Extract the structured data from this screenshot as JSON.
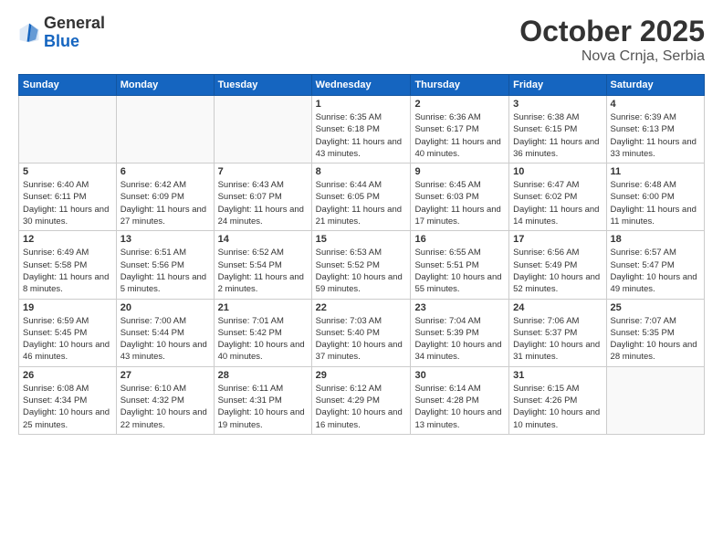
{
  "logo": {
    "general": "General",
    "blue": "Blue"
  },
  "header": {
    "month": "October 2025",
    "location": "Nova Crnja, Serbia"
  },
  "days_of_week": [
    "Sunday",
    "Monday",
    "Tuesday",
    "Wednesday",
    "Thursday",
    "Friday",
    "Saturday"
  ],
  "weeks": [
    [
      {
        "day": "",
        "info": ""
      },
      {
        "day": "",
        "info": ""
      },
      {
        "day": "",
        "info": ""
      },
      {
        "day": "1",
        "info": "Sunrise: 6:35 AM\nSunset: 6:18 PM\nDaylight: 11 hours\nand 43 minutes."
      },
      {
        "day": "2",
        "info": "Sunrise: 6:36 AM\nSunset: 6:17 PM\nDaylight: 11 hours\nand 40 minutes."
      },
      {
        "day": "3",
        "info": "Sunrise: 6:38 AM\nSunset: 6:15 PM\nDaylight: 11 hours\nand 36 minutes."
      },
      {
        "day": "4",
        "info": "Sunrise: 6:39 AM\nSunset: 6:13 PM\nDaylight: 11 hours\nand 33 minutes."
      }
    ],
    [
      {
        "day": "5",
        "info": "Sunrise: 6:40 AM\nSunset: 6:11 PM\nDaylight: 11 hours\nand 30 minutes."
      },
      {
        "day": "6",
        "info": "Sunrise: 6:42 AM\nSunset: 6:09 PM\nDaylight: 11 hours\nand 27 minutes."
      },
      {
        "day": "7",
        "info": "Sunrise: 6:43 AM\nSunset: 6:07 PM\nDaylight: 11 hours\nand 24 minutes."
      },
      {
        "day": "8",
        "info": "Sunrise: 6:44 AM\nSunset: 6:05 PM\nDaylight: 11 hours\nand 21 minutes."
      },
      {
        "day": "9",
        "info": "Sunrise: 6:45 AM\nSunset: 6:03 PM\nDaylight: 11 hours\nand 17 minutes."
      },
      {
        "day": "10",
        "info": "Sunrise: 6:47 AM\nSunset: 6:02 PM\nDaylight: 11 hours\nand 14 minutes."
      },
      {
        "day": "11",
        "info": "Sunrise: 6:48 AM\nSunset: 6:00 PM\nDaylight: 11 hours\nand 11 minutes."
      }
    ],
    [
      {
        "day": "12",
        "info": "Sunrise: 6:49 AM\nSunset: 5:58 PM\nDaylight: 11 hours\nand 8 minutes."
      },
      {
        "day": "13",
        "info": "Sunrise: 6:51 AM\nSunset: 5:56 PM\nDaylight: 11 hours\nand 5 minutes."
      },
      {
        "day": "14",
        "info": "Sunrise: 6:52 AM\nSunset: 5:54 PM\nDaylight: 11 hours\nand 2 minutes."
      },
      {
        "day": "15",
        "info": "Sunrise: 6:53 AM\nSunset: 5:52 PM\nDaylight: 10 hours\nand 59 minutes."
      },
      {
        "day": "16",
        "info": "Sunrise: 6:55 AM\nSunset: 5:51 PM\nDaylight: 10 hours\nand 55 minutes."
      },
      {
        "day": "17",
        "info": "Sunrise: 6:56 AM\nSunset: 5:49 PM\nDaylight: 10 hours\nand 52 minutes."
      },
      {
        "day": "18",
        "info": "Sunrise: 6:57 AM\nSunset: 5:47 PM\nDaylight: 10 hours\nand 49 minutes."
      }
    ],
    [
      {
        "day": "19",
        "info": "Sunrise: 6:59 AM\nSunset: 5:45 PM\nDaylight: 10 hours\nand 46 minutes."
      },
      {
        "day": "20",
        "info": "Sunrise: 7:00 AM\nSunset: 5:44 PM\nDaylight: 10 hours\nand 43 minutes."
      },
      {
        "day": "21",
        "info": "Sunrise: 7:01 AM\nSunset: 5:42 PM\nDaylight: 10 hours\nand 40 minutes."
      },
      {
        "day": "22",
        "info": "Sunrise: 7:03 AM\nSunset: 5:40 PM\nDaylight: 10 hours\nand 37 minutes."
      },
      {
        "day": "23",
        "info": "Sunrise: 7:04 AM\nSunset: 5:39 PM\nDaylight: 10 hours\nand 34 minutes."
      },
      {
        "day": "24",
        "info": "Sunrise: 7:06 AM\nSunset: 5:37 PM\nDaylight: 10 hours\nand 31 minutes."
      },
      {
        "day": "25",
        "info": "Sunrise: 7:07 AM\nSunset: 5:35 PM\nDaylight: 10 hours\nand 28 minutes."
      }
    ],
    [
      {
        "day": "26",
        "info": "Sunrise: 6:08 AM\nSunset: 4:34 PM\nDaylight: 10 hours\nand 25 minutes."
      },
      {
        "day": "27",
        "info": "Sunrise: 6:10 AM\nSunset: 4:32 PM\nDaylight: 10 hours\nand 22 minutes."
      },
      {
        "day": "28",
        "info": "Sunrise: 6:11 AM\nSunset: 4:31 PM\nDaylight: 10 hours\nand 19 minutes."
      },
      {
        "day": "29",
        "info": "Sunrise: 6:12 AM\nSunset: 4:29 PM\nDaylight: 10 hours\nand 16 minutes."
      },
      {
        "day": "30",
        "info": "Sunrise: 6:14 AM\nSunset: 4:28 PM\nDaylight: 10 hours\nand 13 minutes."
      },
      {
        "day": "31",
        "info": "Sunrise: 6:15 AM\nSunset: 4:26 PM\nDaylight: 10 hours\nand 10 minutes."
      },
      {
        "day": "",
        "info": ""
      }
    ]
  ]
}
